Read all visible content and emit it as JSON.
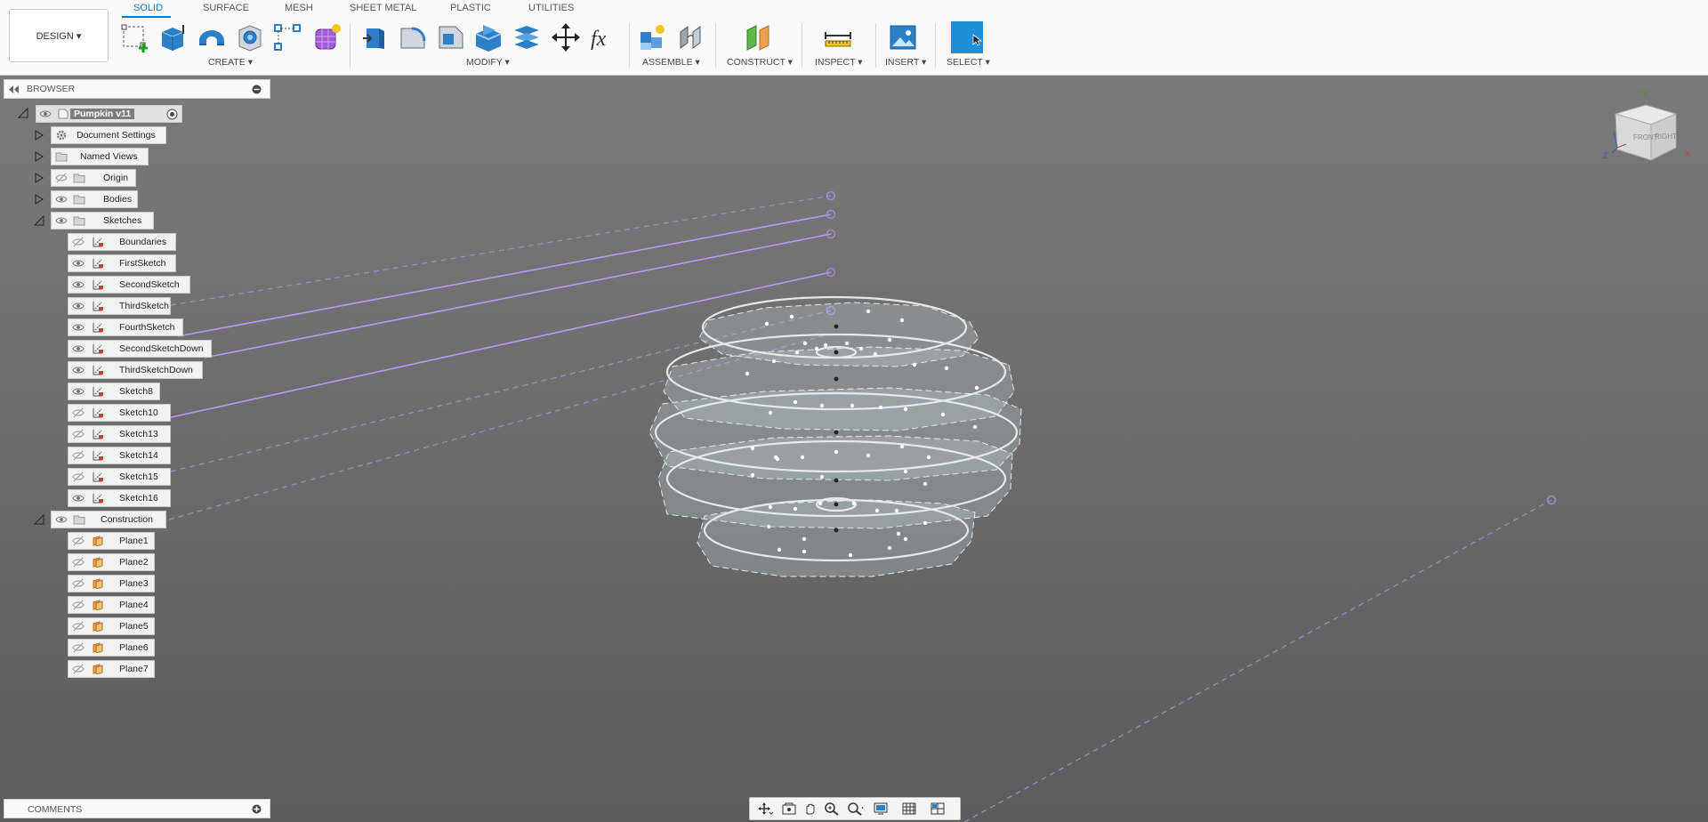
{
  "toolbar": {
    "design_label": "DESIGN ▾",
    "tabs": [
      "SOLID",
      "SURFACE",
      "MESH",
      "SHEET METAL",
      "PLASTIC",
      "UTILITIES"
    ],
    "groups": {
      "create": "CREATE ▾",
      "modify": "MODIFY ▾",
      "assemble": "ASSEMBLE ▾",
      "construct": "CONSTRUCT ▾",
      "inspect": "INSPECT ▾",
      "insert": "INSERT ▾",
      "select": "SELECT ▾"
    },
    "accent": "#0b7bd0"
  },
  "browser": {
    "title": "BROWSER",
    "root": "Pumpkin v11",
    "items": [
      {
        "label": "Document Settings"
      },
      {
        "label": "Named Views"
      },
      {
        "label": "Origin"
      },
      {
        "label": "Bodies"
      },
      {
        "label": "Sketches"
      }
    ],
    "sketches": [
      "Boundaries",
      "FirstSketch",
      "SecondSketch",
      "ThirdSketch",
      "FourthSketch",
      "SecondSketchDown",
      "ThirdSketchDown",
      "Sketch8",
      "Sketch10",
      "Sketch13",
      "Sketch14",
      "Sketch15",
      "Sketch16"
    ],
    "construction_label": "Construction",
    "planes": [
      "Plane1",
      "Plane2",
      "Plane3",
      "Plane4",
      "Plane5",
      "Plane6",
      "Plane7"
    ]
  },
  "comments": {
    "title": "COMMENTS"
  },
  "viewcube": {
    "front": "FRONT",
    "right": "RIGHT",
    "x": "X",
    "y": "Y",
    "z": "Z"
  }
}
